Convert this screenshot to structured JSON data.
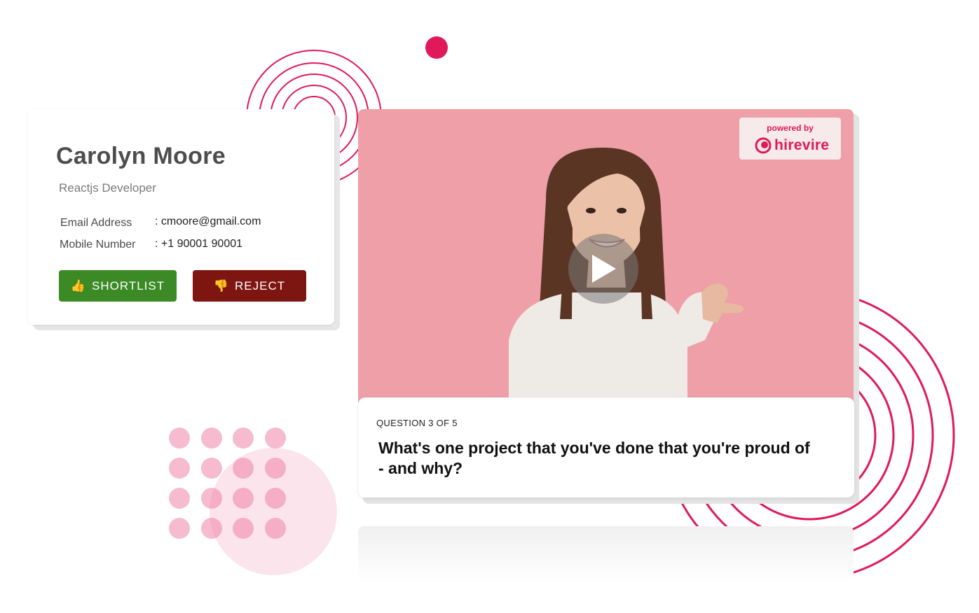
{
  "candidate": {
    "name": "Carolyn Moore",
    "role": "Reactjs Developer",
    "email_label": "Email Address",
    "email_value": ": cmoore@gmail.com",
    "mobile_label": "Mobile Number",
    "mobile_value": ": +1 90001 90001",
    "shortlist_icon": "👍",
    "shortlist_label": "SHORTLIST",
    "reject_icon": "👎",
    "reject_label": "REJECT"
  },
  "video": {
    "powered_by": "powered by",
    "brand": "hirevire",
    "play_icon": "play-icon"
  },
  "question": {
    "counter": "QUESTION 3 OF 5",
    "text": "What's one project that you've done that you're proud of - and why?"
  },
  "colors": {
    "accent": "#e0195a",
    "shortlist": "#3b8a25",
    "reject": "#7d1510",
    "video_bg": "#ee9fa8"
  }
}
